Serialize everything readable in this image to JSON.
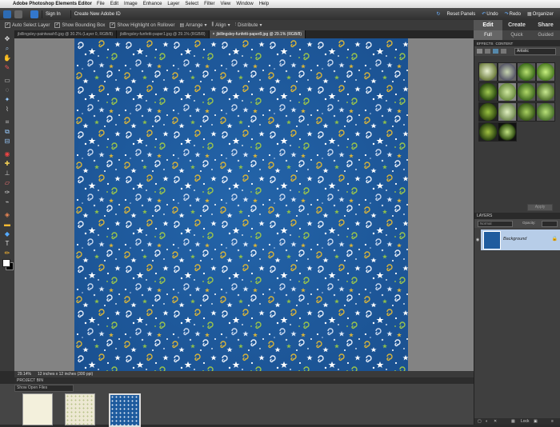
{
  "menubar": {
    "app_name": "Adobe Photoshop Elements Editor",
    "items": [
      "File",
      "Edit",
      "Image",
      "Enhance",
      "Layer",
      "Select",
      "Filter",
      "View",
      "Window",
      "Help"
    ]
  },
  "appbar": {
    "sign_in": "Sign In",
    "create_id": "Create New Adobe ID",
    "reset_panels": "Reset Panels",
    "undo": "Undo",
    "redo": "Redo",
    "organizer": "Organizer"
  },
  "options": {
    "auto_select": "Auto Select Layer",
    "bounding_box": "Show Bounding Box",
    "highlight": "Show Highlight on Rollover",
    "arrange": "Arrange",
    "align": "Align",
    "distribute": "Distribute"
  },
  "mode_tabs": [
    "Edit",
    "Create",
    "Share"
  ],
  "edit_subtabs": [
    "Full",
    "Quick",
    "Guided"
  ],
  "doc_tabs": [
    {
      "label": "jbillingsley-paintwash5.jpg @ 30.2% (Layer 0, RGB/8)",
      "active": false
    },
    {
      "label": "jbillingsley-funfetti-paper1.jpg @ 29.1% (RGB/8)",
      "active": false
    },
    {
      "label": "jbillingsley-funfetti-paper8.jpg @ 29.1% (RGB/8)",
      "active": true
    }
  ],
  "status": {
    "zoom": "29.14%",
    "doc_size": "12 inches x 12 inches (300 ppi)"
  },
  "project_bin": {
    "title": "PROJECT BIN",
    "dropdown": "Show Open Files"
  },
  "effects": {
    "tab_effects": "EFFECTS",
    "tab_content": "CONTENT",
    "category": "Artistic",
    "apply": "Apply"
  },
  "layers": {
    "title": "LAYERS",
    "blend": "Normal",
    "opacity_label": "Opacity:",
    "layer_name": "Background",
    "lock_label": "Lock"
  },
  "colors": {
    "paper": "#1f5c9e",
    "paper_dark": "#17477d",
    "canvas_bg": "#838383",
    "selected_layer": "#b7cde8"
  }
}
